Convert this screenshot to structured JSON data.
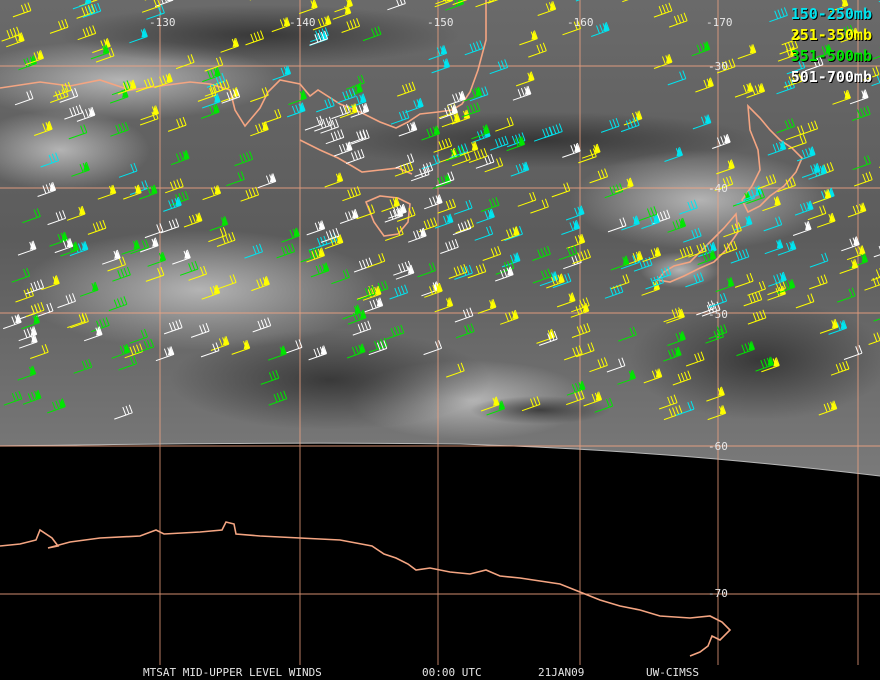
{
  "map": {
    "longitude_labels": [
      "-130",
      "-140",
      "-150",
      "-160",
      "-170"
    ],
    "latitude_labels": [
      "-30",
      "-40",
      "-50",
      "-60",
      "-70"
    ],
    "colors": {
      "grid": "#f4a582",
      "coastline": "#f4a582",
      "earth_disk_edge": "#b8b8b8",
      "space": "#000000"
    }
  },
  "legend": [
    {
      "label": "150-250mb",
      "color": "#00e5f0"
    },
    {
      "label": "251-350mb",
      "color": "#ffff00"
    },
    {
      "label": "351-500mb",
      "color": "#00e600"
    },
    {
      "label": "501-700mb",
      "color": "#ffffff"
    }
  ],
  "footer": {
    "title": "MTSAT MID-UPPER LEVEL WINDS",
    "time": "00:00 UTC",
    "date": "21JAN09",
    "source": "UW-CIMSS"
  }
}
